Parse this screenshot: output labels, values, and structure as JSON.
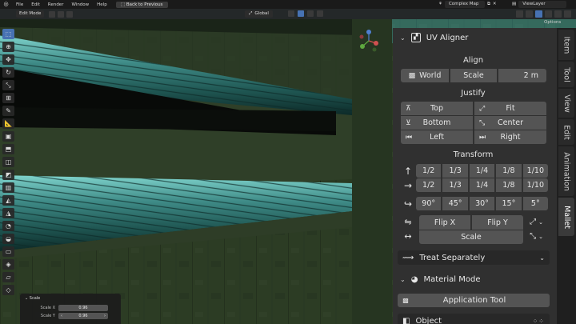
{
  "topbar": {
    "menus": [
      "File",
      "Edit",
      "Render",
      "Window",
      "Help"
    ],
    "back_button": "Back to Previous",
    "scene": "Complex Map",
    "view_layer": "ViewLayer"
  },
  "viewport_header": {
    "mode": "Edit Mode",
    "orientation": "Global",
    "options": "Options"
  },
  "operator_panel": {
    "title": "Scale",
    "rows": [
      {
        "label": "Scale X",
        "value": "0.96"
      },
      {
        "label": "Scale Y",
        "value": "0.96"
      }
    ]
  },
  "npanel": {
    "tabs": [
      "Item",
      "Tool",
      "View",
      "Edit",
      "Animation",
      "Mallet"
    ],
    "active_tab": "Mallet",
    "uv_aligner": {
      "title": "UV Aligner",
      "align": {
        "title": "Align",
        "world": "World",
        "scale": "Scale",
        "value": "2 m"
      },
      "justify": {
        "title": "Justify",
        "top": "Top",
        "fit": "Fit",
        "bottom": "Bottom",
        "center": "Center",
        "left": "Left",
        "right": "Right"
      },
      "transform": {
        "title": "Transform",
        "fractions_up": [
          "1/2",
          "1/3",
          "1/4",
          "1/8",
          "1/10"
        ],
        "fractions_right": [
          "1/2",
          "1/3",
          "1/4",
          "1/8",
          "1/10"
        ],
        "rotations": [
          "90°",
          "45°",
          "30°",
          "15°",
          "5°"
        ],
        "flip_x": "Flip X",
        "flip_y": "Flip Y",
        "scale": "Scale"
      },
      "treat": "Treat Separately"
    },
    "material_mode": {
      "title": "Material Mode",
      "application_tool": "Application Tool",
      "object": "Object"
    }
  },
  "colors": {
    "panel_bg": "#303030",
    "button_bg": "#545454",
    "accent_blue": "#4772b3",
    "pipe_teal": "#3e8a86"
  }
}
